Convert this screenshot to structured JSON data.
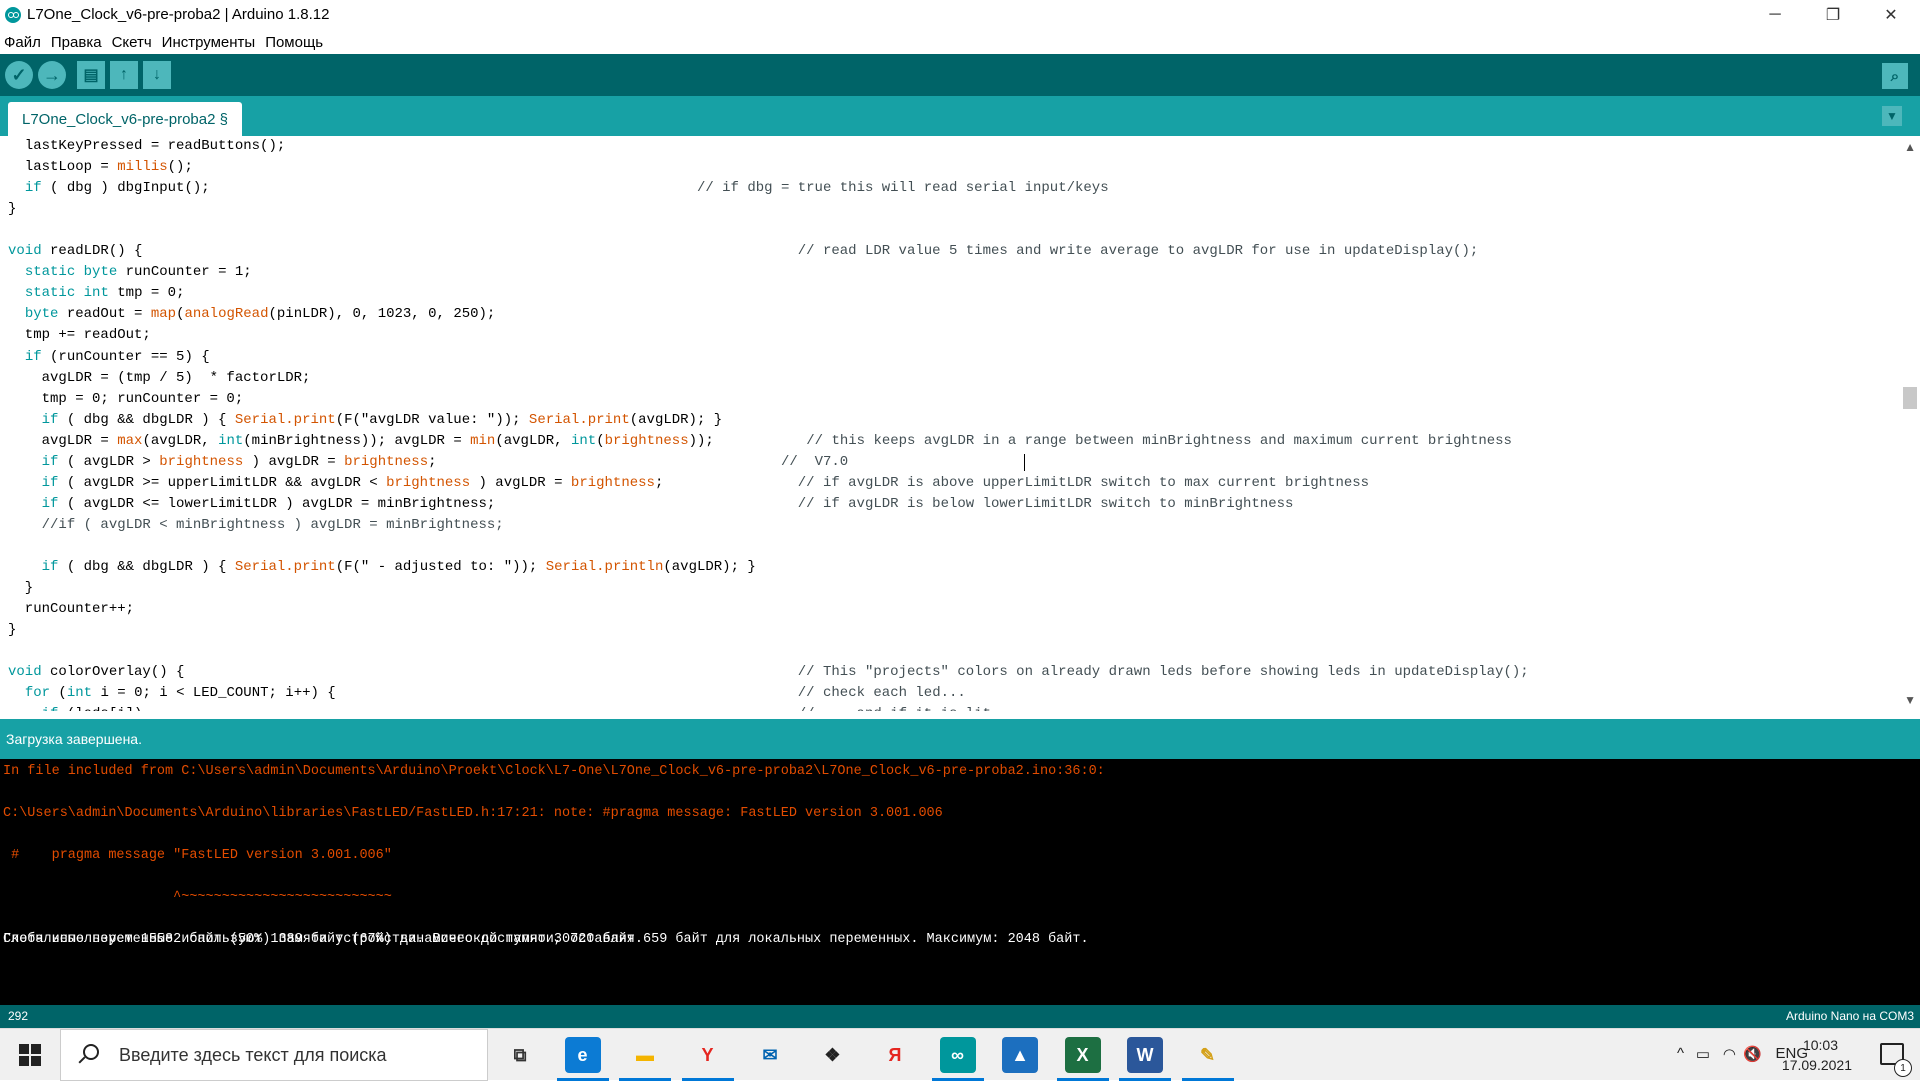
{
  "window": {
    "title": "L7One_Clock_v6-pre-proba2 | Arduino 1.8.12",
    "minimize": "─",
    "maximize": "❐",
    "close": "✕"
  },
  "menu": [
    "Файл",
    "Правка",
    "Скетч",
    "Инструменты",
    "Помощь"
  ],
  "toolbar": {
    "verify": "✓",
    "upload": "→",
    "new": "▤",
    "open": "↑",
    "save": "↓",
    "serial_monitor": "⌕"
  },
  "tab": {
    "label": "L7One_Clock_v6-pre-proba2 §",
    "menu_arrow": "▼"
  },
  "code_lines": [
    "  lastKeyPressed = readButtons();",
    "  lastLoop = millis();",
    "  if ( dbg ) dbgInput();                                                          // if dbg = true this will read serial input/keys",
    "}",
    "",
    "void readLDR() {                                                                              // read LDR value 5 times and write average to avgLDR for use in updateDisplay();",
    "  static byte runCounter = 1;",
    "  static int tmp = 0;",
    "  byte readOut = map(analogRead(pinLDR), 0, 1023, 0, 250);",
    "  tmp += readOut;",
    "  if (runCounter == 5) {",
    "    avgLDR = (tmp / 5)  * factorLDR;",
    "    tmp = 0; runCounter = 0;",
    "    if ( dbg && dbgLDR ) { Serial.print(F(\"avgLDR value: \")); Serial.print(avgLDR); }",
    "    avgLDR = max(avgLDR, int(minBrightness)); avgLDR = min(avgLDR, int(brightness));           // this keeps avgLDR in a range between minBrightness and maximum current brightness",
    "    if ( avgLDR > brightness ) avgLDR = brightness;                                         //  V7.0",
    "    if ( avgLDR >= upperLimitLDR && avgLDR < brightness ) avgLDR = brightness;                // if avgLDR is above upperLimitLDR switch to max current brightness",
    "    if ( avgLDR <= lowerLimitLDR ) avgLDR = minBrightness;                                    // if avgLDR is below lowerLimitLDR switch to minBrightness",
    "    //if ( avgLDR < minBrightness ) avgLDR = minBrightness;",
    "",
    "    if ( dbg && dbgLDR ) { Serial.print(F(\" - adjusted to: \")); Serial.println(avgLDR); }",
    "  }",
    "  runCounter++;",
    "}",
    "",
    "void colorOverlay() {                                                                         // This \"projects\" colors on already drawn leds before showing leds in updateDisplay();",
    "  for (int i = 0; i < LED_COUNT; i++) {                                                       // check each led...",
    "    if (leds[i])                                                                              //     and if it is lit"
  ],
  "status": {
    "message": "Загрузка завершена."
  },
  "console_lines": [
    {
      "text": "In file included from C:\\Users\\admin\\Documents\\Arduino\\Proekt\\Clock\\L7-One\\L7One_Clock_v6-pre-proba2\\L7One_Clock_v6-pre-proba2.ino:36:0:",
      "kind": "err"
    },
    {
      "text": "",
      "kind": "err"
    },
    {
      "text": "C:\\Users\\admin\\Documents\\Arduino\\libraries\\FastLED/FastLED.h:17:21: note: #pragma message: FastLED version 3.001.006",
      "kind": "err"
    },
    {
      "text": "",
      "kind": "err"
    },
    {
      "text": " #    pragma message \"FastLED version 3.001.006\"",
      "kind": "err"
    },
    {
      "text": "",
      "kind": "err"
    },
    {
      "text": "                     ^~~~~~~~~~~~~~~~~~~~~~~~~~~",
      "kind": "err"
    },
    {
      "text": "",
      "kind": "err"
    },
    {
      "text": "Скетч использует 15582 байт (50%) памяти устройства. Всего доступно 30720 байт.",
      "kind": "info"
    },
    {
      "text": "Глобальные переменные используют 1389 байт (67%) динамической памяти, оставляя 659 байт для локальных переменных. Максимум: 2048 байт.",
      "kind": "info"
    }
  ],
  "footer": {
    "line_number": "292",
    "board": "Arduino Nano на COM3"
  },
  "taskbar": {
    "search_placeholder": "Введите здесь текст для поиска",
    "apps": [
      {
        "name": "task-view-icon",
        "glyph": "⧉",
        "color": "#333333",
        "bg": "transparent"
      },
      {
        "name": "edge-icon",
        "glyph": "e",
        "color": "#ffffff",
        "bg": "#0c7bd4"
      },
      {
        "name": "file-explorer-icon",
        "glyph": "▬",
        "color": "#f4b400",
        "bg": "transparent"
      },
      {
        "name": "yandex-icon",
        "glyph": "Y",
        "color": "#e52620",
        "bg": "transparent"
      },
      {
        "name": "mail-icon",
        "glyph": "✉",
        "color": "#0063b1",
        "bg": "transparent"
      },
      {
        "name": "dropbox-icon",
        "glyph": "❖",
        "color": "#222222",
        "bg": "transparent"
      },
      {
        "name": "yandex-browser-icon",
        "glyph": "Я",
        "color": "#e52620",
        "bg": "transparent"
      },
      {
        "name": "arduino-icon",
        "glyph": "∞",
        "color": "#ffffff",
        "bg": "#00979c"
      },
      {
        "name": "photos-icon",
        "glyph": "▲",
        "color": "#ffffff",
        "bg": "#1c6fbf"
      },
      {
        "name": "excel-icon",
        "glyph": "X",
        "color": "#ffffff",
        "bg": "#1d6f42"
      },
      {
        "name": "word-icon",
        "glyph": "W",
        "color": "#ffffff",
        "bg": "#2b579a"
      },
      {
        "name": "paint-icon",
        "glyph": "✎",
        "color": "#d4a017",
        "bg": "transparent"
      }
    ],
    "tray": {
      "chevron": "^",
      "battery": "▭",
      "wifi": "◠",
      "volume": "🔇",
      "lang": "ENG"
    },
    "time": "10:03",
    "date": "17.09.2021",
    "notifications": "1"
  },
  "colors": {
    "teal_dark": "#006468",
    "teal": "#17a1a5",
    "keyword": "#00979c",
    "function": "#d35400",
    "console_error": "#e34c00"
  }
}
